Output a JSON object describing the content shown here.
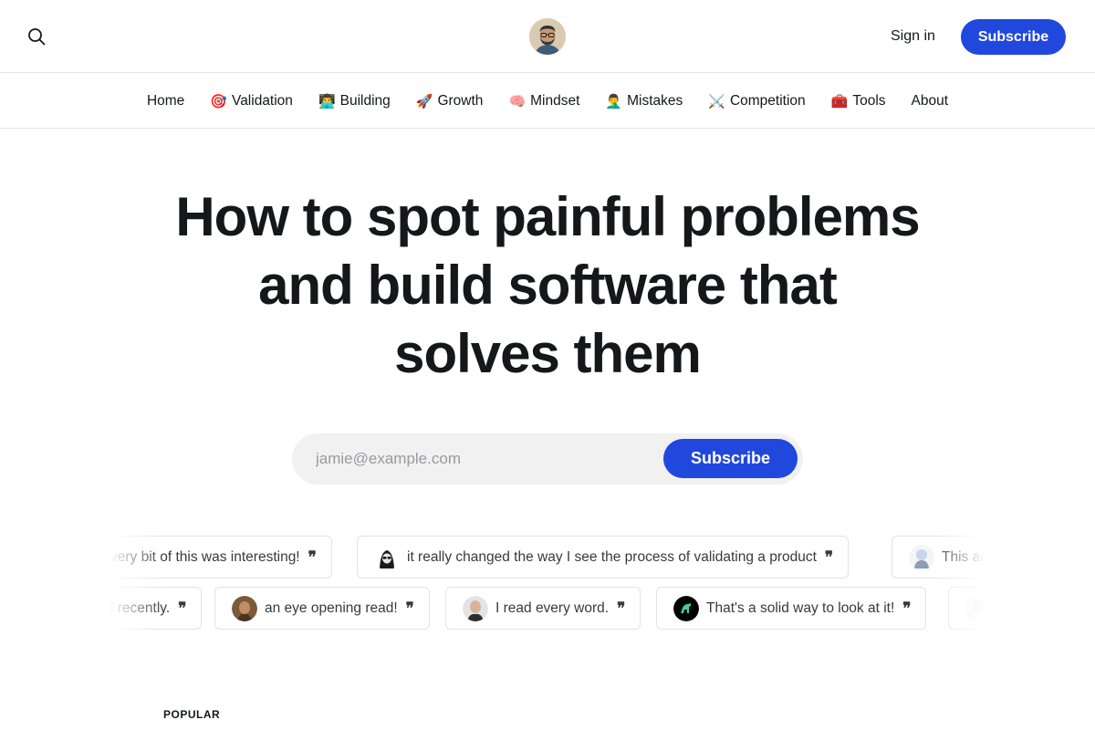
{
  "header": {
    "signin_label": "Sign in",
    "subscribe_label": "Subscribe",
    "icons": {
      "search": "search-icon",
      "logo": "avatar-logo"
    }
  },
  "nav": {
    "items": [
      {
        "emoji": "",
        "label": "Home"
      },
      {
        "emoji": "🎯",
        "label": "Validation"
      },
      {
        "emoji": "👨‍💻",
        "label": "Building"
      },
      {
        "emoji": "🚀",
        "label": "Growth"
      },
      {
        "emoji": "🧠",
        "label": "Mindset"
      },
      {
        "emoji": "🤦‍♂️",
        "label": "Mistakes"
      },
      {
        "emoji": "⚔️",
        "label": "Competition"
      },
      {
        "emoji": "🧰",
        "label": "Tools"
      },
      {
        "emoji": "",
        "label": "About"
      }
    ]
  },
  "hero": {
    "headline_line1": "How to spot painful problems",
    "headline_line2": "and build software that",
    "headline_line3": "solves them",
    "email_placeholder": "jamie@example.com",
    "subscribe_label": "Subscribe"
  },
  "testimonials": {
    "row1": [
      {
        "text": "very bit of this was interesting!"
      },
      {
        "text": "it really changed the way I see the process of validating a product"
      },
      {
        "text": "This ac"
      }
    ],
    "row2": [
      {
        "text": "l recently."
      },
      {
        "text": "an eye opening read!"
      },
      {
        "text": "I read every word."
      },
      {
        "text": "That's a solid way to look at it!"
      }
    ],
    "quote_mark": "❞"
  },
  "sections": {
    "popular_label": "POPULAR"
  },
  "colors": {
    "accent": "#2148dc",
    "text": "#15171a",
    "border": "#e6e6e6",
    "input_bg": "#f1f1f1"
  }
}
